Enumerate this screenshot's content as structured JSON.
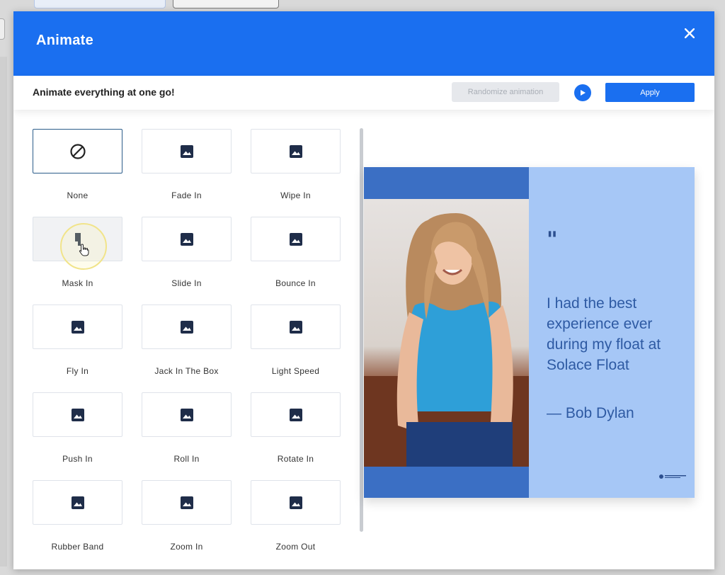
{
  "modal": {
    "title": "Animate",
    "subtitle": "Animate everything at one go!",
    "randomize_label": "Randomize animation",
    "apply_label": "Apply"
  },
  "animations": [
    {
      "label": "None",
      "icon": "no-animation-icon"
    },
    {
      "label": "Fade In",
      "icon": "image-icon"
    },
    {
      "label": "Wipe In",
      "icon": "image-icon"
    },
    {
      "label": "Mask In",
      "icon": "image-icon"
    },
    {
      "label": "Slide In",
      "icon": "image-icon"
    },
    {
      "label": "Bounce In",
      "icon": "image-icon"
    },
    {
      "label": "Fly In",
      "icon": "image-icon"
    },
    {
      "label": "Jack In The Box",
      "icon": "image-icon"
    },
    {
      "label": "Light Speed",
      "icon": "image-icon"
    },
    {
      "label": "Push In",
      "icon": "image-icon"
    },
    {
      "label": "Roll In",
      "icon": "image-icon"
    },
    {
      "label": "Rotate In",
      "icon": "image-icon"
    },
    {
      "label": "Rubber Band",
      "icon": "image-icon"
    },
    {
      "label": "Zoom In",
      "icon": "image-icon"
    },
    {
      "label": "Zoom Out",
      "icon": "image-icon"
    }
  ],
  "selected_animation": "None",
  "hovered_animation": "Mask In",
  "preview": {
    "quote_mark": "\"",
    "quote": "I had the best experience ever during my float at Solace Float",
    "author": "— Bob Dylan"
  },
  "colors": {
    "primary": "#1a6ff0",
    "preview_dark": "#3b6fc4",
    "preview_light": "#a6c7f6",
    "quote_text": "#2e5aa3"
  }
}
